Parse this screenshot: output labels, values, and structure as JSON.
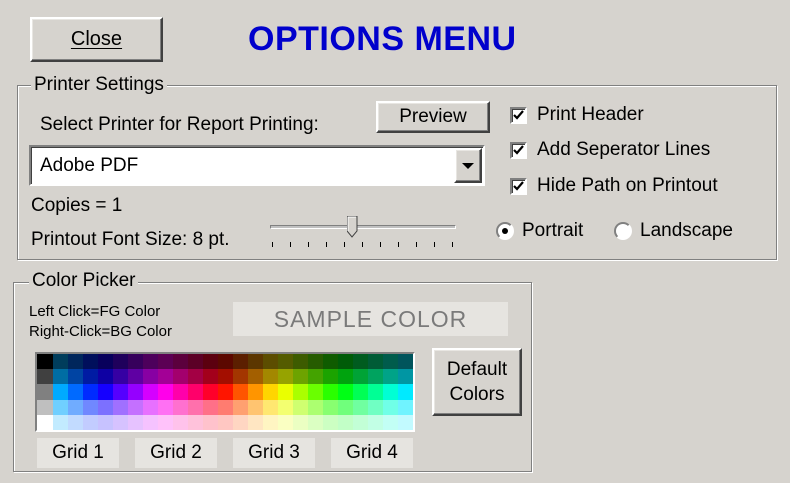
{
  "header": {
    "close_label": "Close",
    "title": "OPTIONS MENU",
    "title_color": "#0000cc"
  },
  "printer": {
    "legend": "Printer Settings",
    "select_label": "Select Printer for Report Printing:",
    "preview_label": "Preview",
    "printer_value": "Adobe PDF",
    "copies_text": "Copies = 1",
    "font_size_text": "Printout Font Size: 8 pt.",
    "font_size_pt": 8,
    "slider_fraction": 0.44,
    "checkboxes": [
      {
        "label": "Print Header",
        "checked": true
      },
      {
        "label": "Add Seperator Lines",
        "checked": true
      },
      {
        "label": "Hide Path on Printout",
        "checked": true
      }
    ],
    "orientation": {
      "portrait_label": "Portrait",
      "landscape_label": "Landscape",
      "selected": "Portrait"
    }
  },
  "color_picker": {
    "legend": "Color Picker",
    "hint_line1": "Left Click=FG Color",
    "hint_line2": "Right-Click=BG Color",
    "sample_label": "SAMPLE COLOR",
    "default_line1": "Default",
    "default_line2": "Colors",
    "grids": [
      "Grid 1",
      "Grid 2",
      "Grid 3",
      "Grid 4"
    ]
  }
}
